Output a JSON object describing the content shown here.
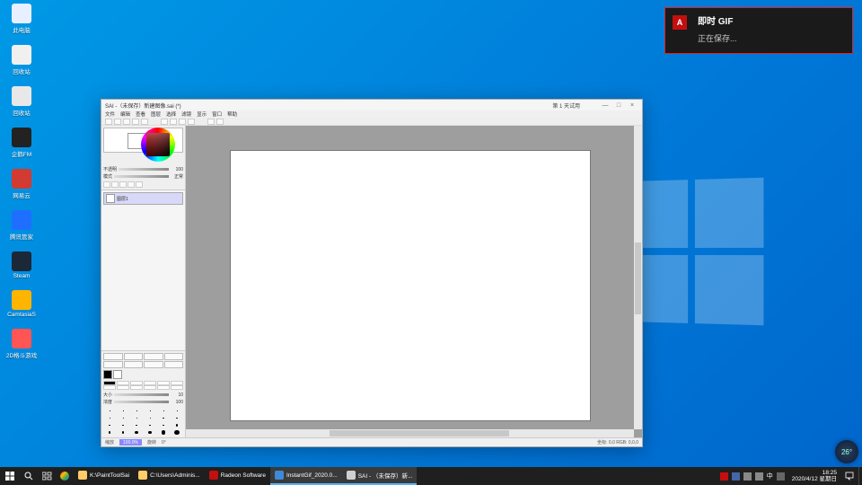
{
  "desktop_icons": [
    {
      "label": "此电脑",
      "color": "#e8f0ff"
    },
    {
      "label": "回收站",
      "color": "#f0f0f0"
    },
    {
      "label": "回收站",
      "color": "#e8e8e8"
    },
    {
      "label": "企鹅FM",
      "color": "#222"
    },
    {
      "label": "网易云",
      "color": "#d33a31"
    },
    {
      "label": "腾讯管家",
      "color": "#1e6fff"
    },
    {
      "label": "Steam",
      "color": "#1b2838"
    },
    {
      "label": "CamtasiaS",
      "color": "#ffb400"
    },
    {
      "label": "2D格斗游戏",
      "color": "#ff5555"
    }
  ],
  "toast": {
    "brand": "A",
    "title": "即时 GIF",
    "body": "正在保存..."
  },
  "sai": {
    "title": "SAI -（未保存）新建图像.sai (*)",
    "trial": "第 1 天试用",
    "menus": [
      "文件",
      "编辑",
      "查看",
      "图层",
      "选择",
      "滤镜",
      "显示",
      "窗口",
      "帮助"
    ],
    "layer_name": "图层1",
    "zoom": "100.0%",
    "rotation": "0°",
    "status_right": "坐标: 0,0  RGB: 0,0,0"
  },
  "taskbar": {
    "tasks": [
      {
        "label": "K:\\PaintToolSai",
        "color": "#ffcc66"
      },
      {
        "label": "C:\\Users\\Adminis...",
        "color": "#ffcc66"
      },
      {
        "label": "Radeon Software",
        "color": "#c40f0f"
      },
      {
        "label": "InstantGif_2020.0...",
        "color": "#4089d6",
        "active": true
      },
      {
        "label": "SAI - （未保存）新...",
        "color": "#cfcfcf",
        "active": true
      }
    ],
    "time": "18:25",
    "date": "2020/4/12 星期日",
    "temp": "26°"
  }
}
